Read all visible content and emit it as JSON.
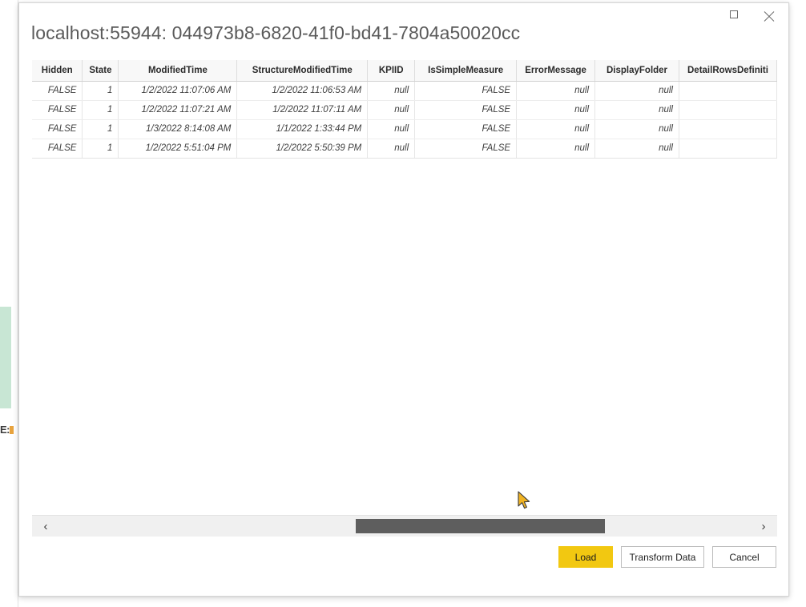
{
  "window": {
    "title": "localhost:55944: 044973b8-6820-41f0-bd41-7804a50020cc",
    "maximize_label": "Maximize",
    "close_label": "Close"
  },
  "background": {
    "left_label": "E:"
  },
  "table": {
    "columns": [
      "Hidden",
      "State",
      "ModifiedTime",
      "StructureModifiedTime",
      "KPIID",
      "IsSimpleMeasure",
      "ErrorMessage",
      "DisplayFolder",
      "DetailRowsDefiniti"
    ],
    "rows": [
      [
        "FALSE",
        "1",
        "1/2/2022 11:07:06 AM",
        "1/2/2022 11:06:53 AM",
        "null",
        "FALSE",
        "null",
        "null",
        ""
      ],
      [
        "FALSE",
        "1",
        "1/2/2022 11:07:21 AM",
        "1/2/2022 11:07:11 AM",
        "null",
        "FALSE",
        "null",
        "null",
        ""
      ],
      [
        "FALSE",
        "1",
        "1/3/2022 8:14:08 AM",
        "1/1/2022 1:33:44 PM",
        "null",
        "FALSE",
        "null",
        "null",
        ""
      ],
      [
        "FALSE",
        "1",
        "1/2/2022 5:51:04 PM",
        "1/2/2022 5:50:39 PM",
        "null",
        "FALSE",
        "null",
        "null",
        ""
      ]
    ]
  },
  "scrollbar": {
    "left_arrow": "‹",
    "right_arrow": "›"
  },
  "footer": {
    "load_label": "Load",
    "transform_label": "Transform Data",
    "cancel_label": "Cancel"
  },
  "colors": {
    "accent": "#f2c811",
    "scroll_thumb": "#5e5e5e",
    "background_band": "#c8e6d4"
  }
}
